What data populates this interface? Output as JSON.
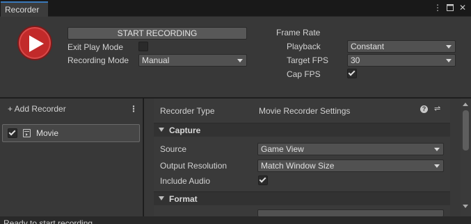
{
  "window": {
    "tab_title": "Recorder"
  },
  "top": {
    "start_recording_label": "START RECORDING",
    "exit_play_mode_label": "Exit Play Mode",
    "exit_play_mode_checked": false,
    "recording_mode_label": "Recording Mode",
    "recording_mode_value": "Manual",
    "frame_rate_label": "Frame Rate",
    "playback_label": "Playback",
    "playback_value": "Constant",
    "target_fps_label": "Target FPS",
    "target_fps_value": "30",
    "cap_fps_label": "Cap FPS",
    "cap_fps_checked": true
  },
  "recorders": {
    "add_label": "+ Add Recorder",
    "items": [
      {
        "name": "Movie",
        "enabled": true
      }
    ]
  },
  "settings": {
    "recorder_type_label": "Recorder Type",
    "recorder_type_value": "Movie Recorder Settings",
    "capture_title": "Capture",
    "source_label": "Source",
    "source_value": "Game View",
    "output_resolution_label": "Output Resolution",
    "output_resolution_value": "Match Window Size",
    "include_audio_label": "Include Audio",
    "include_audio_checked": true,
    "format_title": "Format"
  },
  "status": {
    "text": "Ready to start recording"
  },
  "colors": {
    "record_button": "#c22a2a",
    "tab_accent": "#3a79bb",
    "panel_bg": "#383838"
  }
}
